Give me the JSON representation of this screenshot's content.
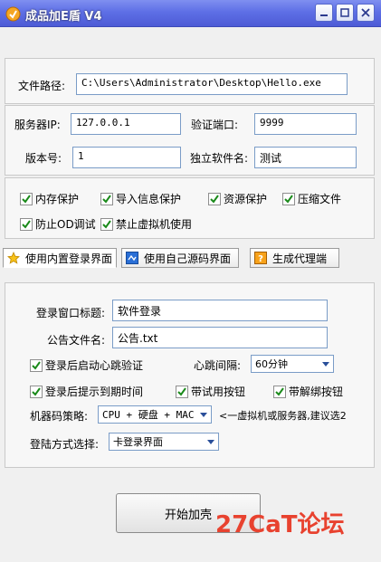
{
  "window": {
    "title": "成品加E盾 V4"
  },
  "file": {
    "path_label": "文件路径:",
    "path_value": "C:\\Users\\Administrator\\Desktop\\Hello.exe"
  },
  "server": {
    "ip_label": "服务器IP:",
    "ip_value": "127.0.0.1",
    "port_label": "验证端口:",
    "port_value": "9999",
    "version_label": "版本号:",
    "version_value": "1",
    "software_label": "独立软件名:",
    "software_value": "测试"
  },
  "options": [
    {
      "label": "内存保护",
      "checked": true
    },
    {
      "label": "导入信息保护",
      "checked": true
    },
    {
      "label": "资源保护",
      "checked": true
    },
    {
      "label": "压缩文件",
      "checked": true
    },
    {
      "label": "防止OD调试",
      "checked": true
    },
    {
      "label": "禁止虚拟机使用",
      "checked": true
    }
  ],
  "tabs": [
    {
      "label": "使用内置登录界面",
      "active": true
    },
    {
      "label": "使用自己源码界面",
      "active": false
    },
    {
      "label": "生成代理端",
      "active": false
    }
  ],
  "login": {
    "title_label": "登录窗口标题:",
    "title_value": "软件登录",
    "notice_label": "公告文件名:",
    "notice_value": "公告.txt",
    "heartbeat_check": "登录后启动心跳验证",
    "interval_label": "心跳间隔:",
    "interval_value": "60分钟",
    "expire_check": "登录后提示到期时间",
    "trial_check": "带试用按钮",
    "unbind_check": "带解绑按钮",
    "machine_label": "机器码策略:",
    "machine_value": "CPU + 硬盘 + MAC",
    "machine_hint": "<一虚拟机或服务器,建议选2",
    "method_label": "登陆方式选择:",
    "method_value": "卡登录界面"
  },
  "actions": {
    "start_label": "开始加壳"
  },
  "watermark": {
    "text": "27CaT论坛"
  }
}
